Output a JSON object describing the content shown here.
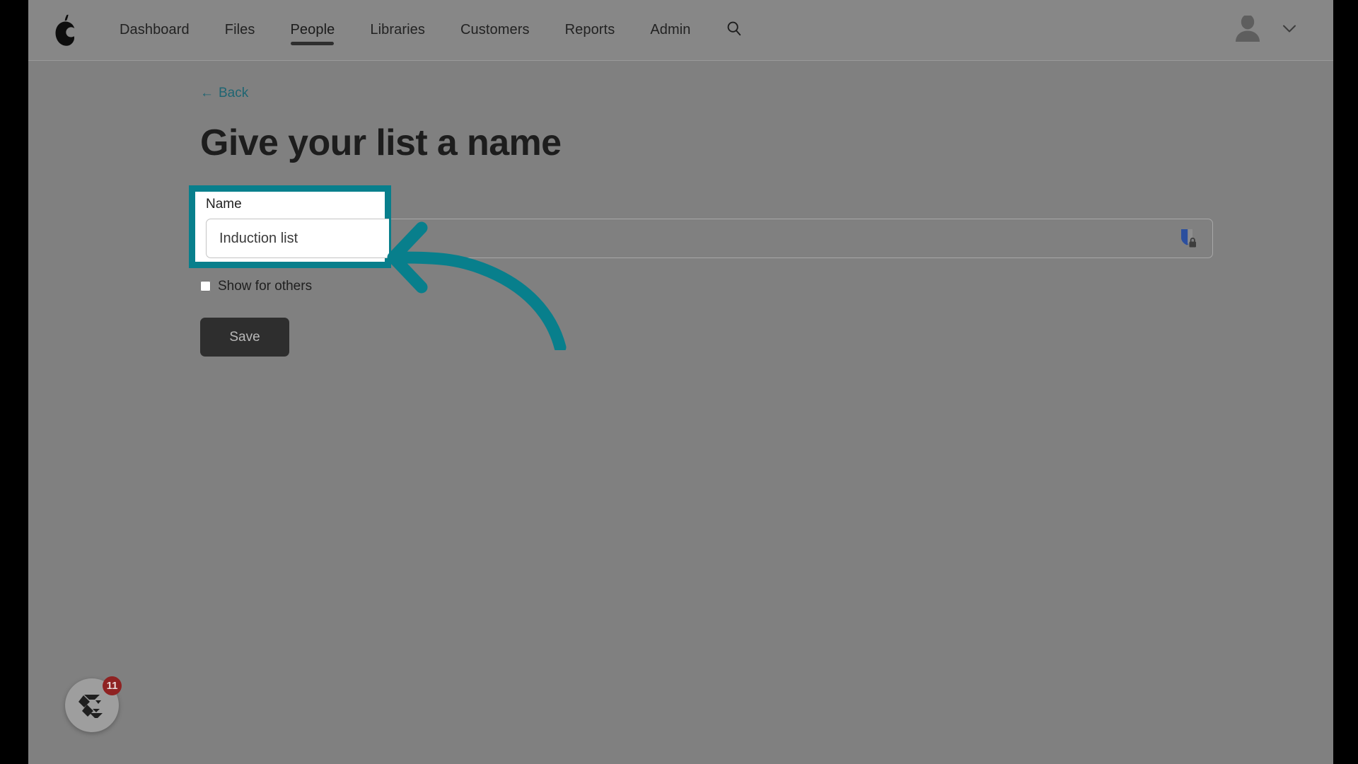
{
  "brand": {
    "logo_icon": "pear-logo-icon"
  },
  "topnav": {
    "items": [
      {
        "label": "Dashboard",
        "active": false
      },
      {
        "label": "Files",
        "active": false
      },
      {
        "label": "People",
        "active": true
      },
      {
        "label": "Libraries",
        "active": false
      },
      {
        "label": "Customers",
        "active": false
      },
      {
        "label": "Reports",
        "active": false
      },
      {
        "label": "Admin",
        "active": false
      }
    ],
    "search_icon": "search-icon",
    "avatar_icon": "user-avatar-icon",
    "chevron_icon": "chevron-down-icon"
  },
  "content": {
    "back": {
      "arrow": "←",
      "label": "Back"
    },
    "title": "Give your list a name",
    "form": {
      "name_label": "Name",
      "name_value": "Induction list",
      "name_placeholder": "",
      "password_manager_icon": "shield-lock-icon",
      "checkbox_label": "Show for others",
      "checkbox_checked": false,
      "save_label": "Save"
    }
  },
  "annotations": {
    "highlight_color": "#087f8c",
    "arrow_color": "#087f8c",
    "arrow_icon": "curved-left-arrow-icon"
  },
  "help_widget": {
    "icon": "chameleon-logo-icon",
    "badge_count": "11",
    "badge_color": "#8f2222"
  }
}
